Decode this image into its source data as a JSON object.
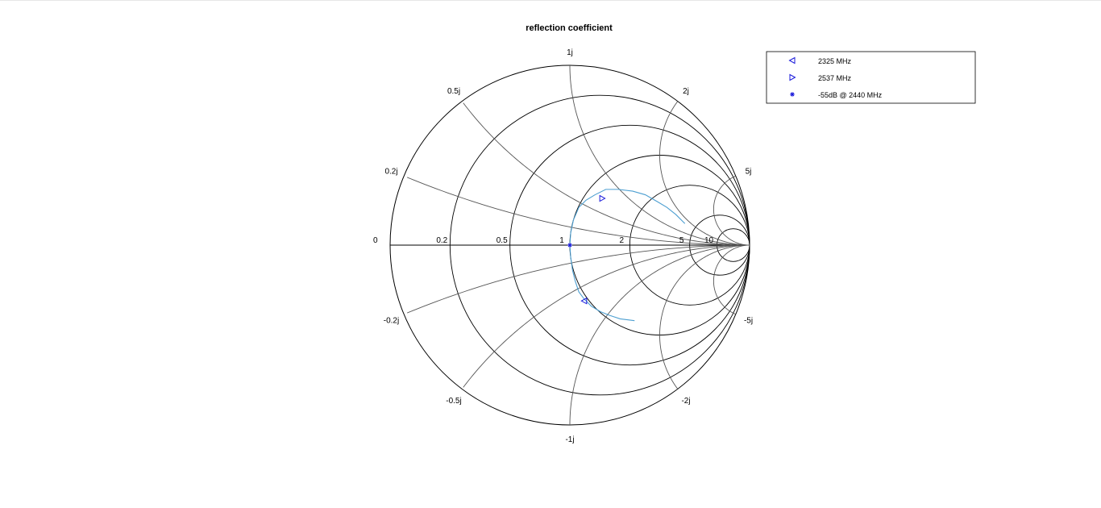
{
  "chart_data": {
    "type": "smith",
    "title": "reflection coefficient",
    "resistance_circles": [
      0.2,
      0.5,
      1,
      2,
      5,
      10
    ],
    "reactance_arcs": [
      0.2,
      0.5,
      1,
      2,
      5
    ],
    "real_tick_labels": [
      "0",
      "0.2",
      "0.5",
      "1",
      "2",
      "5",
      "10"
    ],
    "imag_tick_labels": {
      "positive": [
        "0.2j",
        "0.5j",
        "1j",
        "2j",
        "5j"
      ],
      "negative": [
        "-0.2j",
        "-0.5j",
        "-1j",
        "-2j",
        "-5j"
      ]
    },
    "series": [
      {
        "type": "line",
        "color": "#4d9fd1",
        "gamma": [
          [
            0.36,
            -0.42
          ],
          [
            0.28,
            -0.41
          ],
          [
            0.22,
            -0.39
          ],
          [
            0.17,
            -0.37
          ],
          [
            0.12,
            -0.34
          ],
          [
            0.08,
            -0.3
          ],
          [
            0.05,
            -0.26
          ],
          [
            0.03,
            -0.2
          ],
          [
            0.015,
            -0.14
          ],
          [
            0.005,
            -0.07
          ],
          [
            0.0,
            0.0
          ],
          [
            0.005,
            0.07
          ],
          [
            0.02,
            0.14
          ],
          [
            0.05,
            0.21
          ],
          [
            0.09,
            0.25
          ],
          [
            0.14,
            0.28
          ],
          [
            0.2,
            0.31
          ],
          [
            0.27,
            0.31
          ],
          [
            0.35,
            0.3
          ],
          [
            0.42,
            0.28
          ],
          [
            0.49,
            0.24
          ],
          [
            0.54,
            0.21
          ],
          [
            0.59,
            0.17
          ],
          [
            0.64,
            0.12
          ]
        ]
      }
    ],
    "markers": [
      {
        "label": "2325 MHz",
        "symbol": "triangle-left",
        "color": "#1a1adb",
        "gamma": [
          0.08,
          -0.31
        ]
      },
      {
        "label": "2537 MHz",
        "symbol": "triangle-right",
        "color": "#1a1adb",
        "gamma": [
          0.18,
          0.26
        ]
      },
      {
        "label": "-55dB @ 2440 MHz",
        "symbol": "asterisk",
        "color": "#1a1adb",
        "gamma": [
          0.0,
          0.0
        ]
      }
    ],
    "legend_position": "top-right",
    "grid": true
  }
}
